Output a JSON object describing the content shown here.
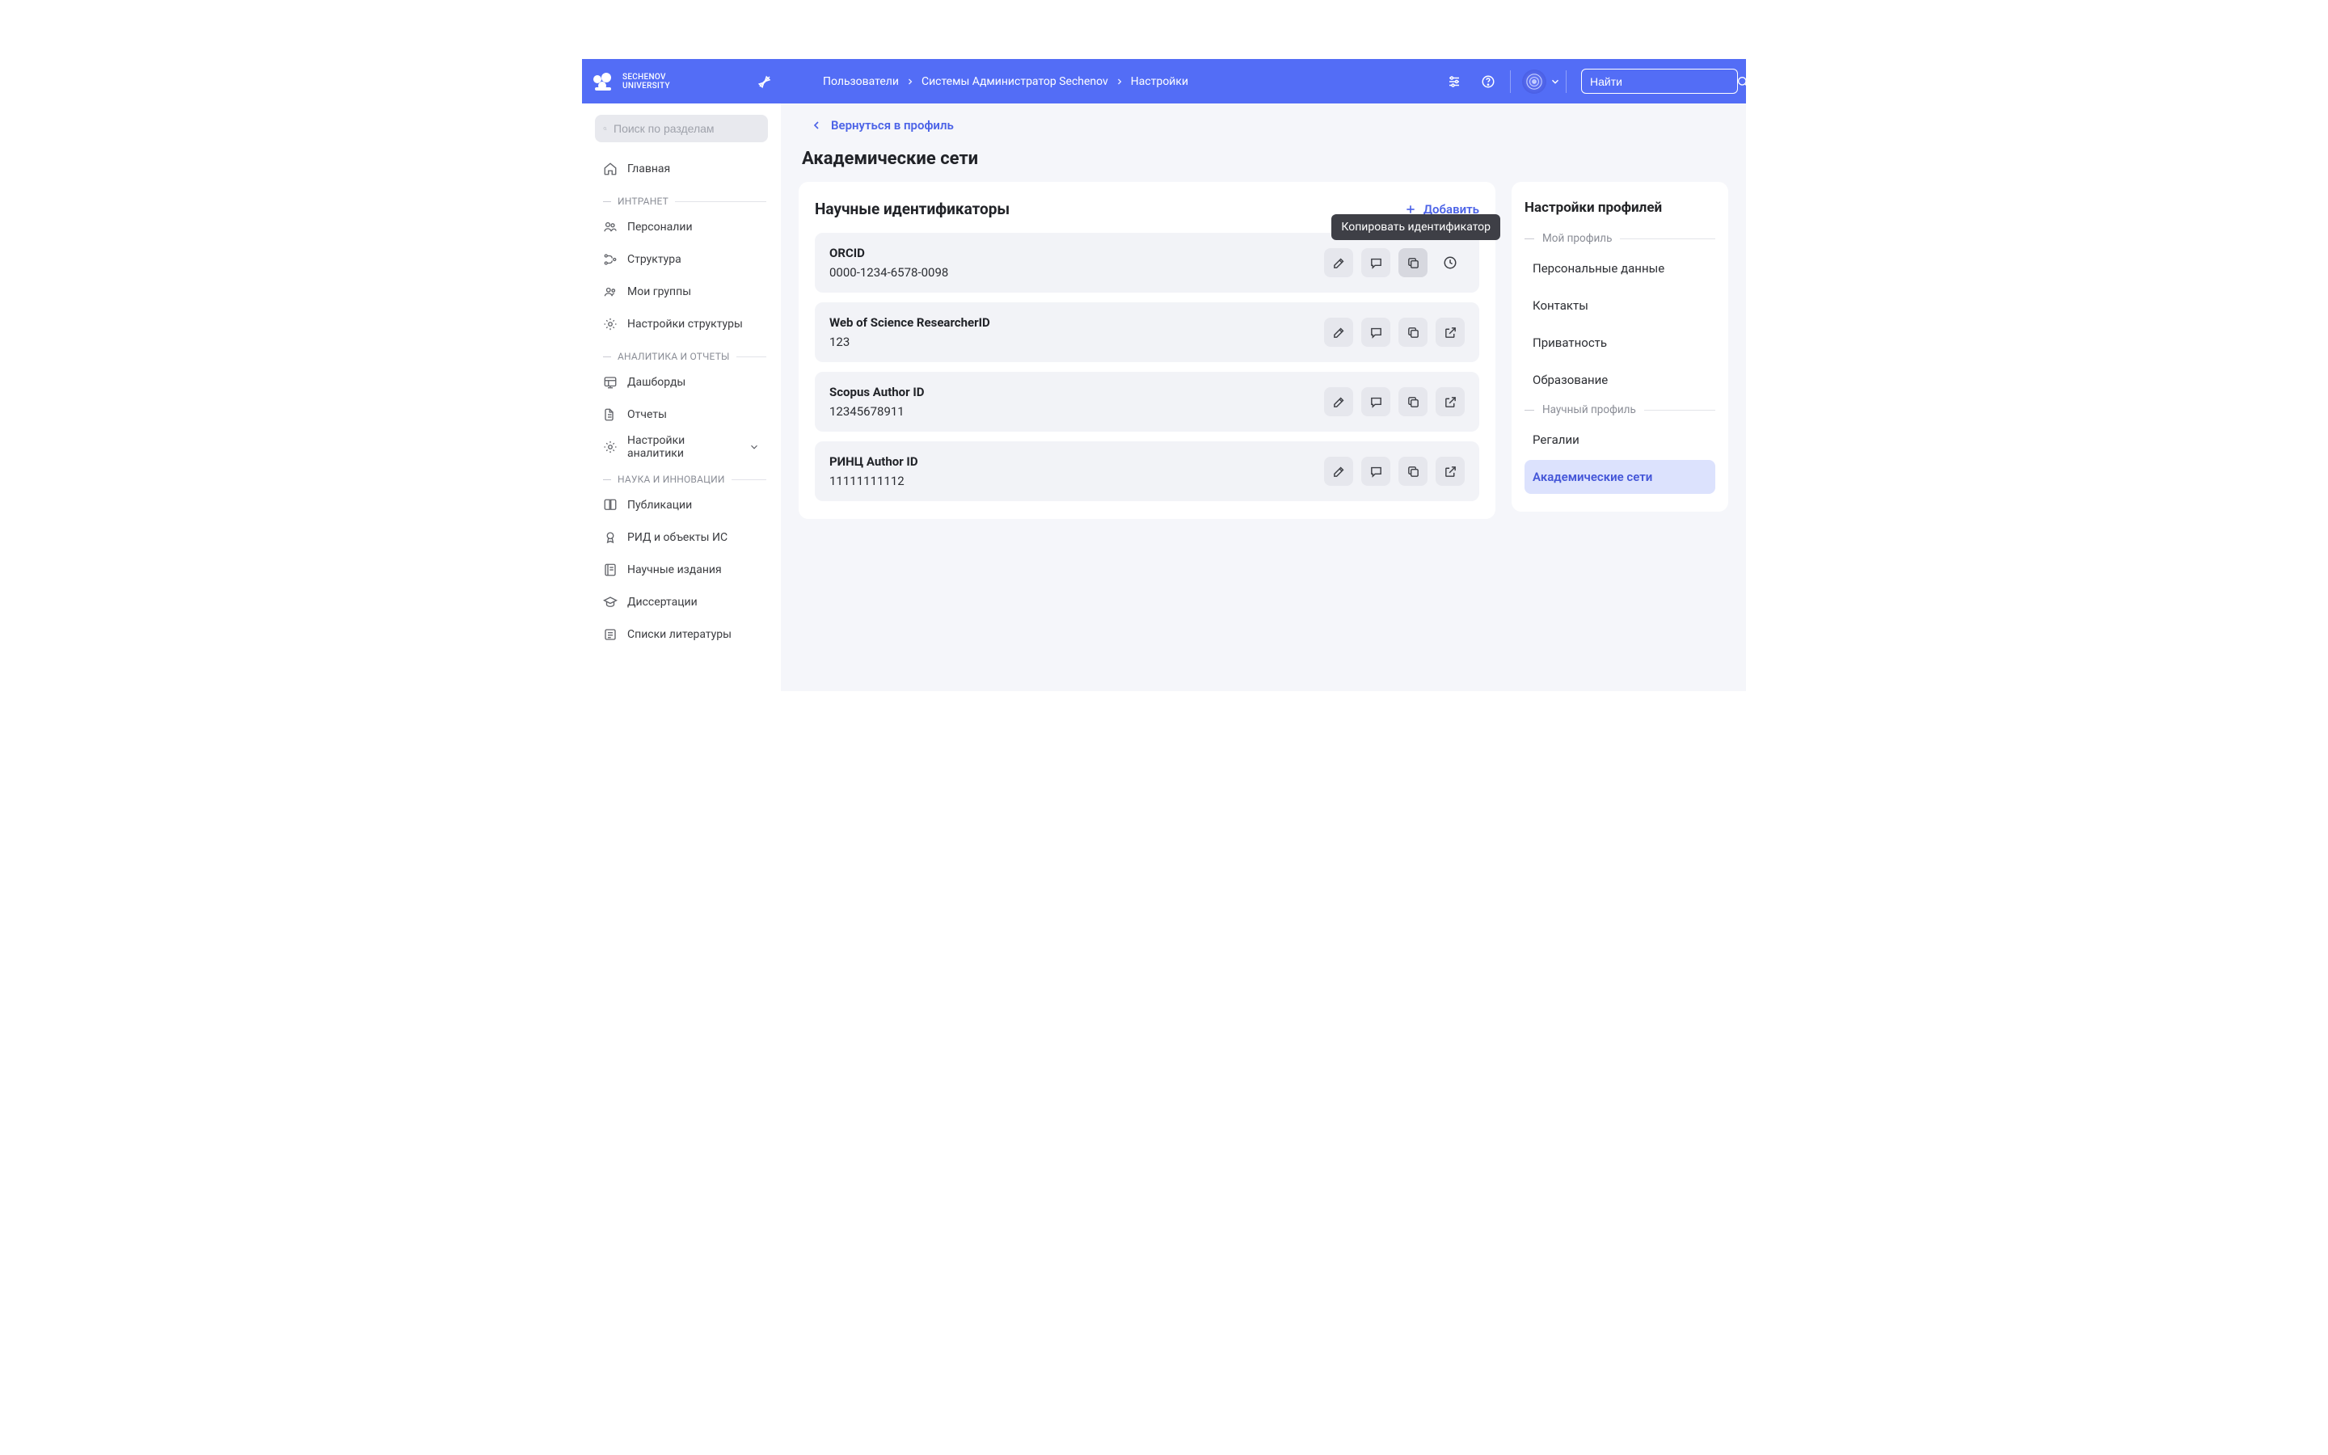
{
  "logo": {
    "line1": "SECHENOV",
    "line2": "UNIVERSITY"
  },
  "breadcrumb": [
    "Пользователи",
    "Системы Администратор Sechenov",
    "Настройки"
  ],
  "header_search_placeholder": "Найти",
  "sidebar": {
    "search_placeholder": "Поиск по разделам",
    "home": "Главная",
    "sections": [
      {
        "label": "ИНТРАНЕТ",
        "items": [
          {
            "icon": "users",
            "label": "Персоналии"
          },
          {
            "icon": "struct",
            "label": "Структура"
          },
          {
            "icon": "groups",
            "label": "Мои группы"
          },
          {
            "icon": "gear",
            "label": "Настройки структуры"
          }
        ]
      },
      {
        "label": "АНАЛИТИКА И ОТЧЕТЫ",
        "items": [
          {
            "icon": "dash",
            "label": "Дашборды"
          },
          {
            "icon": "report",
            "label": "Отчеты"
          },
          {
            "icon": "gear",
            "label": "Настройки аналитики",
            "expand": true
          }
        ]
      },
      {
        "label": "НАУКА И ИННОВАЦИИ",
        "items": [
          {
            "icon": "book",
            "label": "Публикации"
          },
          {
            "icon": "award",
            "label": "РИД и объекты ИС"
          },
          {
            "icon": "journal",
            "label": "Научные издания"
          },
          {
            "icon": "grad",
            "label": "Диссертации"
          },
          {
            "icon": "list",
            "label": "Списки литературы"
          }
        ]
      }
    ]
  },
  "main": {
    "back": "Вернуться в профиль",
    "title": "Академические сети",
    "card_title": "Научные идентификаторы",
    "add": "Добавить",
    "tooltip": "Копировать идентификатор",
    "rows": [
      {
        "name": "ORCID",
        "value": "0000-1234-6578-0098",
        "history": true,
        "copy_active": true
      },
      {
        "name": "Web of Science ResearcherID",
        "value": "123",
        "ext": true
      },
      {
        "name": "Scopus Author ID",
        "value": "12345678911",
        "ext": true
      },
      {
        "name": "РИНЦ Author ID",
        "value": "11111111112",
        "ext": true
      }
    ]
  },
  "right": {
    "title": "Настройки профилей",
    "sec1": "Мой профиль",
    "items1": [
      "Персональные данные",
      "Контакты",
      "Приватность",
      "Образование"
    ],
    "sec2": "Научный профиль",
    "items2": [
      "Регалии",
      "Академические сети"
    ],
    "active": "Академические сети"
  }
}
